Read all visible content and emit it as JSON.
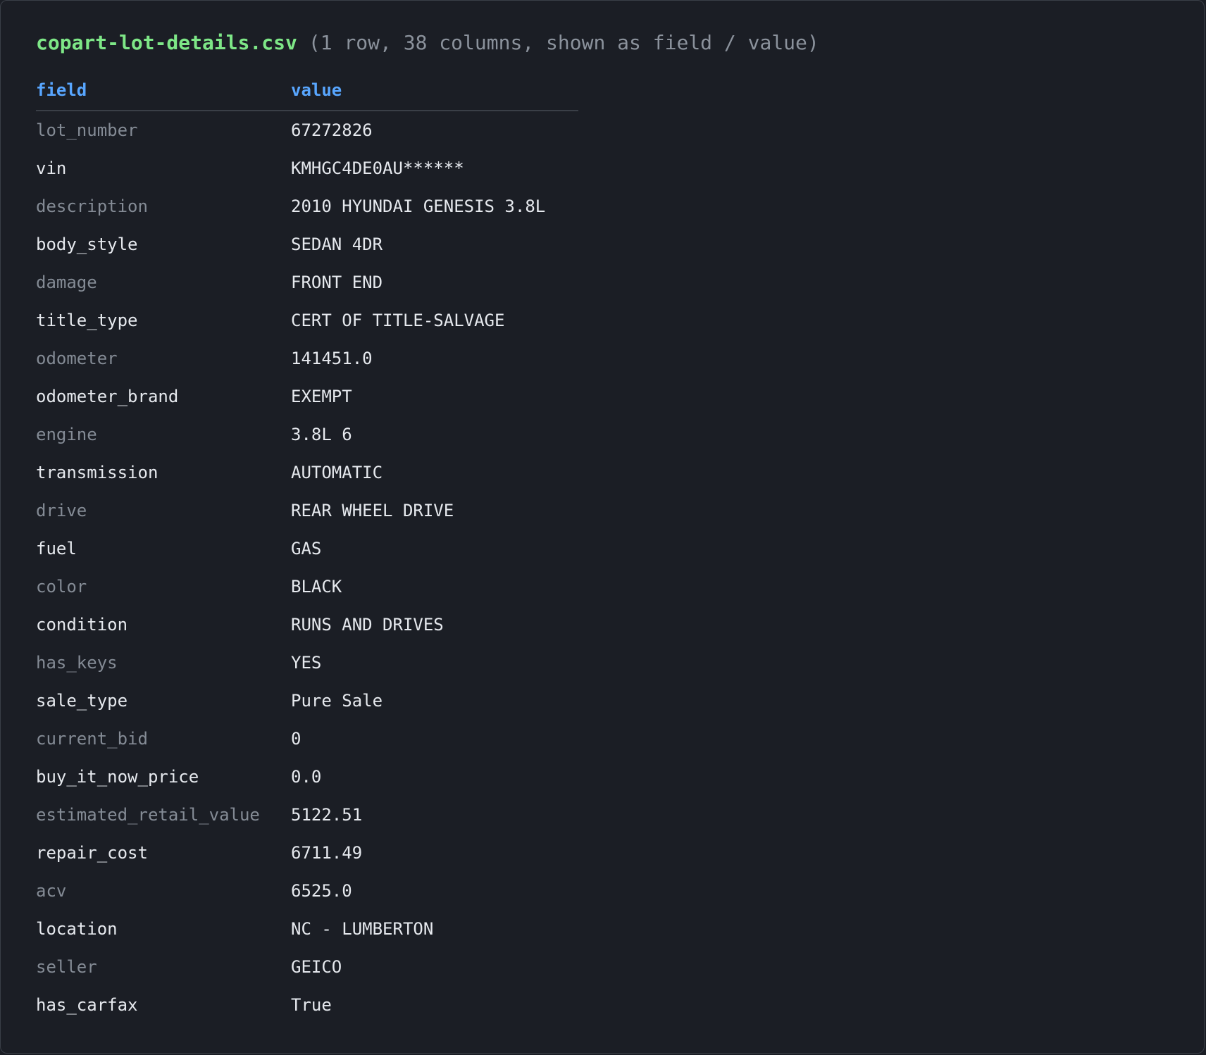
{
  "header": {
    "filename": "copart-lot-details.csv",
    "summary": "(1 row, 38 columns, shown as field / value)"
  },
  "table": {
    "columns": [
      "field",
      "value"
    ],
    "rows": [
      {
        "field": "lot_number",
        "value": "67272826"
      },
      {
        "field": "vin",
        "value": "KMHGC4DE0AU******"
      },
      {
        "field": "description",
        "value": "2010 HYUNDAI GENESIS 3.8L"
      },
      {
        "field": "body_style",
        "value": "SEDAN 4DR"
      },
      {
        "field": "damage",
        "value": "FRONT END"
      },
      {
        "field": "title_type",
        "value": "CERT OF TITLE-SALVAGE"
      },
      {
        "field": "odometer",
        "value": "141451.0"
      },
      {
        "field": "odometer_brand",
        "value": "EXEMPT"
      },
      {
        "field": "engine",
        "value": "3.8L 6"
      },
      {
        "field": "transmission",
        "value": "AUTOMATIC"
      },
      {
        "field": "drive",
        "value": "REAR WHEEL DRIVE"
      },
      {
        "field": "fuel",
        "value": "GAS"
      },
      {
        "field": "color",
        "value": "BLACK"
      },
      {
        "field": "condition",
        "value": "RUNS AND DRIVES"
      },
      {
        "field": "has_keys",
        "value": "YES"
      },
      {
        "field": "sale_type",
        "value": "Pure Sale"
      },
      {
        "field": "current_bid",
        "value": "0"
      },
      {
        "field": "buy_it_now_price",
        "value": "0.0"
      },
      {
        "field": "estimated_retail_value",
        "value": "5122.51"
      },
      {
        "field": "repair_cost",
        "value": "6711.49"
      },
      {
        "field": "acv",
        "value": "6525.0"
      },
      {
        "field": "location",
        "value": "NC - LUMBERTON"
      },
      {
        "field": "seller",
        "value": "GEICO"
      },
      {
        "field": "has_carfax",
        "value": "True"
      }
    ]
  },
  "colors": {
    "background": "#1b1e25",
    "filename": "#7ee787",
    "header_columns": "#58a6ff",
    "muted_text": "#848b95",
    "text": "#e6e9ee"
  }
}
